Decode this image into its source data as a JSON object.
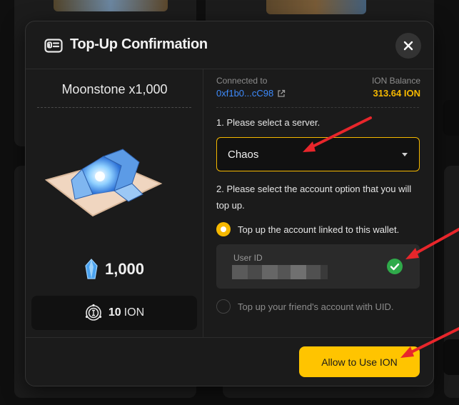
{
  "modal": {
    "title": "Top-Up Confirmation",
    "close_icon": "close-icon",
    "header_icon": "wallet-card-icon"
  },
  "product": {
    "name": "Moonstone x1,000",
    "image": "moonstone-crystals-on-cloth",
    "amount_icon": "moonstone-gem-icon",
    "amount": "1,000",
    "price_icon": "ion-coin-icon",
    "price_value": "10",
    "price_unit": "ION"
  },
  "wallet": {
    "connected_label": "Connected to",
    "address": "0xf1b0...cC98",
    "external_link_icon": "external-link-icon",
    "balance_label": "ION Balance",
    "balance_value": "313.64 ION"
  },
  "form": {
    "step1_label": "1. Please select a server.",
    "server_value": "Chaos",
    "step2_label": "2. Please select the account option that you will top up.",
    "option1_label": "Top up the account linked to this wallet.",
    "option1_selected": true,
    "user_id_label": "User ID",
    "check_icon": "green-check-icon",
    "option2_label": "Top up your friend's account with UID.",
    "option2_selected": false
  },
  "footer": {
    "allow_button_label": "Allow to Use ION"
  },
  "colors": {
    "accent": "#ffc400",
    "link": "#3d8bfd",
    "balance": "#f5b800",
    "success": "#2faa4a",
    "annotation_arrow": "#e8262b"
  }
}
